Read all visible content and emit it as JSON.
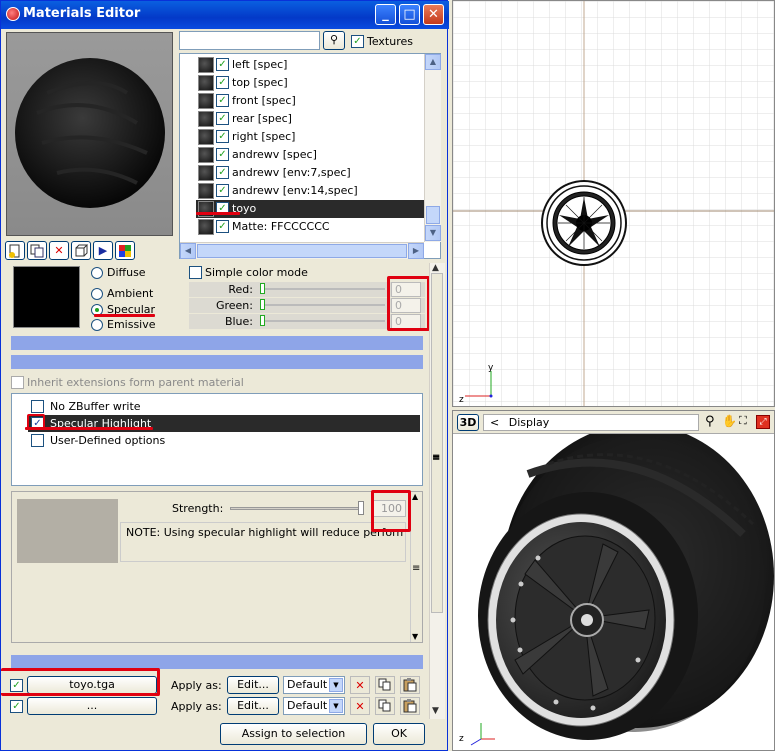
{
  "window": {
    "title": "Materials Editor"
  },
  "toolbar": {
    "textures_label": "Textures",
    "search_value": ""
  },
  "materials": [
    {
      "label": "left [spec]",
      "checked": true
    },
    {
      "label": "top [spec]",
      "checked": true
    },
    {
      "label": "front [spec]",
      "checked": true
    },
    {
      "label": "rear [spec]",
      "checked": true
    },
    {
      "label": "right [spec]",
      "checked": true
    },
    {
      "label": "andrewv [spec]",
      "checked": true
    },
    {
      "label": "andrewv [env:7,spec]",
      "checked": true
    },
    {
      "label": "andrewv [env:14,spec]",
      "checked": true
    },
    {
      "label": "toyo",
      "checked": true,
      "selected": true
    },
    {
      "label": "Matte: FFCCCCCC",
      "checked": true
    }
  ],
  "color_modes": {
    "diffuse": "Diffuse",
    "ambient": "Ambient",
    "specular": "Specular",
    "emissive": "Emissive",
    "selected": "Specular"
  },
  "simple_color_mode": "Simple color mode",
  "channels": [
    {
      "label": "Red:",
      "value": "0"
    },
    {
      "label": "Green:",
      "value": "0"
    },
    {
      "label": "Blue:",
      "value": "0"
    }
  ],
  "inherit_label": "Inherit extensions form parent material",
  "extensions": [
    {
      "label": "No ZBuffer write",
      "checked": false
    },
    {
      "label": "Specular Highlight",
      "checked": true,
      "selected": true
    },
    {
      "label": "User-Defined options",
      "checked": false
    }
  ],
  "strength": {
    "label": "Strength:",
    "value": "100"
  },
  "note": "NOTE: Using specular highlight will reduce performance",
  "textures": [
    {
      "file": "toyo.tga",
      "apply_label": "Apply as:",
      "edit_label": "Edit...",
      "mode": "Default"
    },
    {
      "file": "...",
      "apply_label": "Apply as:",
      "edit_label": "Edit...",
      "mode": "Default"
    }
  ],
  "footer": {
    "assign": "Assign to selection",
    "ok": "OK"
  },
  "viewport_top": {
    "axis_y": "y",
    "axis_z": "z"
  },
  "viewport_bottom": {
    "mode": "3D",
    "nav": "<",
    "display": "Display",
    "axis_z": "z"
  },
  "colors": {
    "title_blue": "#0339c8",
    "selection": "#2a2a2a",
    "annotation_red": "#e00010",
    "bluebar": "#8ea5e8"
  }
}
